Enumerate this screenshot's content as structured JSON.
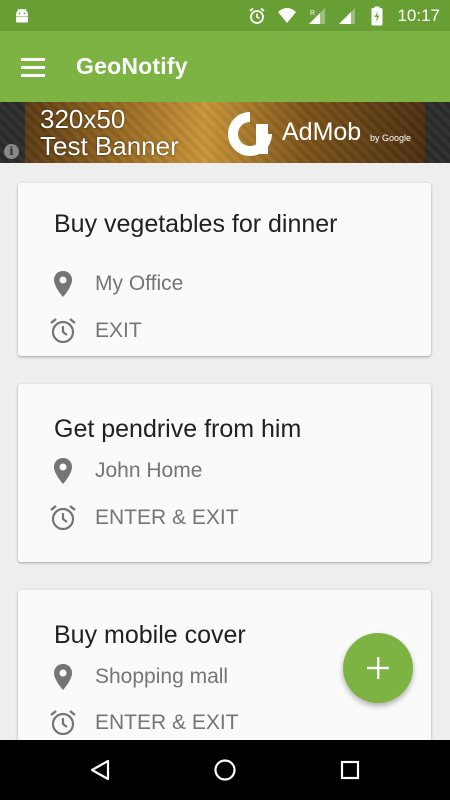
{
  "status_bar": {
    "time": "10:17",
    "left_icon": "android-icon",
    "icons": [
      "alarm-icon",
      "wifi-icon",
      "signal-icon",
      "signal-icon",
      "battery-charging-icon"
    ]
  },
  "app_bar": {
    "title": "GeoNotify",
    "menu_icon": "menu-icon"
  },
  "ad": {
    "line1": "320x50",
    "line2": "Test Banner",
    "brand": "AdMob",
    "brand_sub": "by Google",
    "info_label": "i"
  },
  "reminders": [
    {
      "title": "Buy vegetables for dinner",
      "location": "My Office",
      "trigger": "EXIT"
    },
    {
      "title": "Get pendrive from him",
      "location": "John Home",
      "trigger": "ENTER & EXIT"
    },
    {
      "title": "Buy mobile cover",
      "location": "Shopping mall",
      "trigger": "ENTER & EXIT"
    }
  ],
  "fab": {
    "icon": "plus-icon"
  },
  "nav": {
    "back": "back-icon",
    "home": "home-icon",
    "recents": "recents-icon"
  },
  "colors": {
    "status_bar": "#679f35",
    "app_bar": "#7cb342",
    "fab": "#7cb342",
    "card_bg": "#fafafa",
    "page_bg": "#eeeeee"
  }
}
